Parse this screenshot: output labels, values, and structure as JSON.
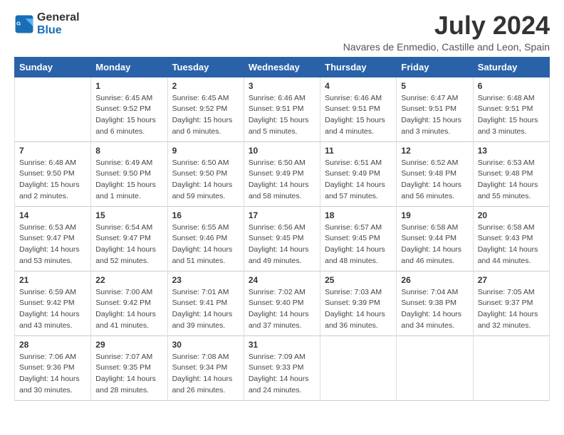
{
  "logo": {
    "line1": "General",
    "line2": "Blue"
  },
  "title": "July 2024",
  "location": "Navares de Enmedio, Castille and Leon, Spain",
  "days_of_week": [
    "Sunday",
    "Monday",
    "Tuesday",
    "Wednesday",
    "Thursday",
    "Friday",
    "Saturday"
  ],
  "weeks": [
    [
      {
        "day": "",
        "sunrise": "",
        "sunset": "",
        "daylight": ""
      },
      {
        "day": "1",
        "sunrise": "Sunrise: 6:45 AM",
        "sunset": "Sunset: 9:52 PM",
        "daylight": "Daylight: 15 hours and 6 minutes."
      },
      {
        "day": "2",
        "sunrise": "Sunrise: 6:45 AM",
        "sunset": "Sunset: 9:52 PM",
        "daylight": "Daylight: 15 hours and 6 minutes."
      },
      {
        "day": "3",
        "sunrise": "Sunrise: 6:46 AM",
        "sunset": "Sunset: 9:51 PM",
        "daylight": "Daylight: 15 hours and 5 minutes."
      },
      {
        "day": "4",
        "sunrise": "Sunrise: 6:46 AM",
        "sunset": "Sunset: 9:51 PM",
        "daylight": "Daylight: 15 hours and 4 minutes."
      },
      {
        "day": "5",
        "sunrise": "Sunrise: 6:47 AM",
        "sunset": "Sunset: 9:51 PM",
        "daylight": "Daylight: 15 hours and 3 minutes."
      },
      {
        "day": "6",
        "sunrise": "Sunrise: 6:48 AM",
        "sunset": "Sunset: 9:51 PM",
        "daylight": "Daylight: 15 hours and 3 minutes."
      }
    ],
    [
      {
        "day": "7",
        "sunrise": "Sunrise: 6:48 AM",
        "sunset": "Sunset: 9:50 PM",
        "daylight": "Daylight: 15 hours and 2 minutes."
      },
      {
        "day": "8",
        "sunrise": "Sunrise: 6:49 AM",
        "sunset": "Sunset: 9:50 PM",
        "daylight": "Daylight: 15 hours and 1 minute."
      },
      {
        "day": "9",
        "sunrise": "Sunrise: 6:50 AM",
        "sunset": "Sunset: 9:50 PM",
        "daylight": "Daylight: 14 hours and 59 minutes."
      },
      {
        "day": "10",
        "sunrise": "Sunrise: 6:50 AM",
        "sunset": "Sunset: 9:49 PM",
        "daylight": "Daylight: 14 hours and 58 minutes."
      },
      {
        "day": "11",
        "sunrise": "Sunrise: 6:51 AM",
        "sunset": "Sunset: 9:49 PM",
        "daylight": "Daylight: 14 hours and 57 minutes."
      },
      {
        "day": "12",
        "sunrise": "Sunrise: 6:52 AM",
        "sunset": "Sunset: 9:48 PM",
        "daylight": "Daylight: 14 hours and 56 minutes."
      },
      {
        "day": "13",
        "sunrise": "Sunrise: 6:53 AM",
        "sunset": "Sunset: 9:48 PM",
        "daylight": "Daylight: 14 hours and 55 minutes."
      }
    ],
    [
      {
        "day": "14",
        "sunrise": "Sunrise: 6:53 AM",
        "sunset": "Sunset: 9:47 PM",
        "daylight": "Daylight: 14 hours and 53 minutes."
      },
      {
        "day": "15",
        "sunrise": "Sunrise: 6:54 AM",
        "sunset": "Sunset: 9:47 PM",
        "daylight": "Daylight: 14 hours and 52 minutes."
      },
      {
        "day": "16",
        "sunrise": "Sunrise: 6:55 AM",
        "sunset": "Sunset: 9:46 PM",
        "daylight": "Daylight: 14 hours and 51 minutes."
      },
      {
        "day": "17",
        "sunrise": "Sunrise: 6:56 AM",
        "sunset": "Sunset: 9:45 PM",
        "daylight": "Daylight: 14 hours and 49 minutes."
      },
      {
        "day": "18",
        "sunrise": "Sunrise: 6:57 AM",
        "sunset": "Sunset: 9:45 PM",
        "daylight": "Daylight: 14 hours and 48 minutes."
      },
      {
        "day": "19",
        "sunrise": "Sunrise: 6:58 AM",
        "sunset": "Sunset: 9:44 PM",
        "daylight": "Daylight: 14 hours and 46 minutes."
      },
      {
        "day": "20",
        "sunrise": "Sunrise: 6:58 AM",
        "sunset": "Sunset: 9:43 PM",
        "daylight": "Daylight: 14 hours and 44 minutes."
      }
    ],
    [
      {
        "day": "21",
        "sunrise": "Sunrise: 6:59 AM",
        "sunset": "Sunset: 9:42 PM",
        "daylight": "Daylight: 14 hours and 43 minutes."
      },
      {
        "day": "22",
        "sunrise": "Sunrise: 7:00 AM",
        "sunset": "Sunset: 9:42 PM",
        "daylight": "Daylight: 14 hours and 41 minutes."
      },
      {
        "day": "23",
        "sunrise": "Sunrise: 7:01 AM",
        "sunset": "Sunset: 9:41 PM",
        "daylight": "Daylight: 14 hours and 39 minutes."
      },
      {
        "day": "24",
        "sunrise": "Sunrise: 7:02 AM",
        "sunset": "Sunset: 9:40 PM",
        "daylight": "Daylight: 14 hours and 37 minutes."
      },
      {
        "day": "25",
        "sunrise": "Sunrise: 7:03 AM",
        "sunset": "Sunset: 9:39 PM",
        "daylight": "Daylight: 14 hours and 36 minutes."
      },
      {
        "day": "26",
        "sunrise": "Sunrise: 7:04 AM",
        "sunset": "Sunset: 9:38 PM",
        "daylight": "Daylight: 14 hours and 34 minutes."
      },
      {
        "day": "27",
        "sunrise": "Sunrise: 7:05 AM",
        "sunset": "Sunset: 9:37 PM",
        "daylight": "Daylight: 14 hours and 32 minutes."
      }
    ],
    [
      {
        "day": "28",
        "sunrise": "Sunrise: 7:06 AM",
        "sunset": "Sunset: 9:36 PM",
        "daylight": "Daylight: 14 hours and 30 minutes."
      },
      {
        "day": "29",
        "sunrise": "Sunrise: 7:07 AM",
        "sunset": "Sunset: 9:35 PM",
        "daylight": "Daylight: 14 hours and 28 minutes."
      },
      {
        "day": "30",
        "sunrise": "Sunrise: 7:08 AM",
        "sunset": "Sunset: 9:34 PM",
        "daylight": "Daylight: 14 hours and 26 minutes."
      },
      {
        "day": "31",
        "sunrise": "Sunrise: 7:09 AM",
        "sunset": "Sunset: 9:33 PM",
        "daylight": "Daylight: 14 hours and 24 minutes."
      },
      {
        "day": "",
        "sunrise": "",
        "sunset": "",
        "daylight": ""
      },
      {
        "day": "",
        "sunrise": "",
        "sunset": "",
        "daylight": ""
      },
      {
        "day": "",
        "sunrise": "",
        "sunset": "",
        "daylight": ""
      }
    ]
  ]
}
